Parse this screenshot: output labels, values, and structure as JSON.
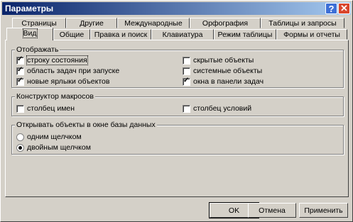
{
  "window": {
    "title": "Параметры"
  },
  "tabs_back": [
    "Страницы",
    "Другие",
    "Международные",
    "Орфография",
    "Таблицы и запросы"
  ],
  "tabs_front": [
    "Вид",
    "Общие",
    "Правка и поиск",
    "Клавиатура",
    "Режим таблицы",
    "Формы и отчеты"
  ],
  "groups": {
    "show": {
      "label": "Отображать",
      "options": [
        {
          "label": "строку состояния",
          "checked": true
        },
        {
          "label": "область задач при запуске",
          "checked": true
        },
        {
          "label": "новые ярлыки объектов",
          "checked": true
        },
        {
          "label": "скрытые объекты",
          "checked": false
        },
        {
          "label": "системные объекты",
          "checked": false
        },
        {
          "label": "окна в панели задач",
          "checked": true
        }
      ]
    },
    "macro": {
      "label": "Конструктор макросов",
      "options": [
        {
          "label": "столбец имен",
          "checked": false
        },
        {
          "label": "столбец условий",
          "checked": false
        }
      ]
    },
    "open": {
      "label": "Открывать объекты в окне базы данных",
      "options": [
        {
          "label": "одним щелчком",
          "checked": false
        },
        {
          "label": "двойным щелчком",
          "checked": true
        }
      ]
    }
  },
  "buttons": {
    "ok": "OK",
    "cancel": "Отмена",
    "apply": "Применить"
  }
}
